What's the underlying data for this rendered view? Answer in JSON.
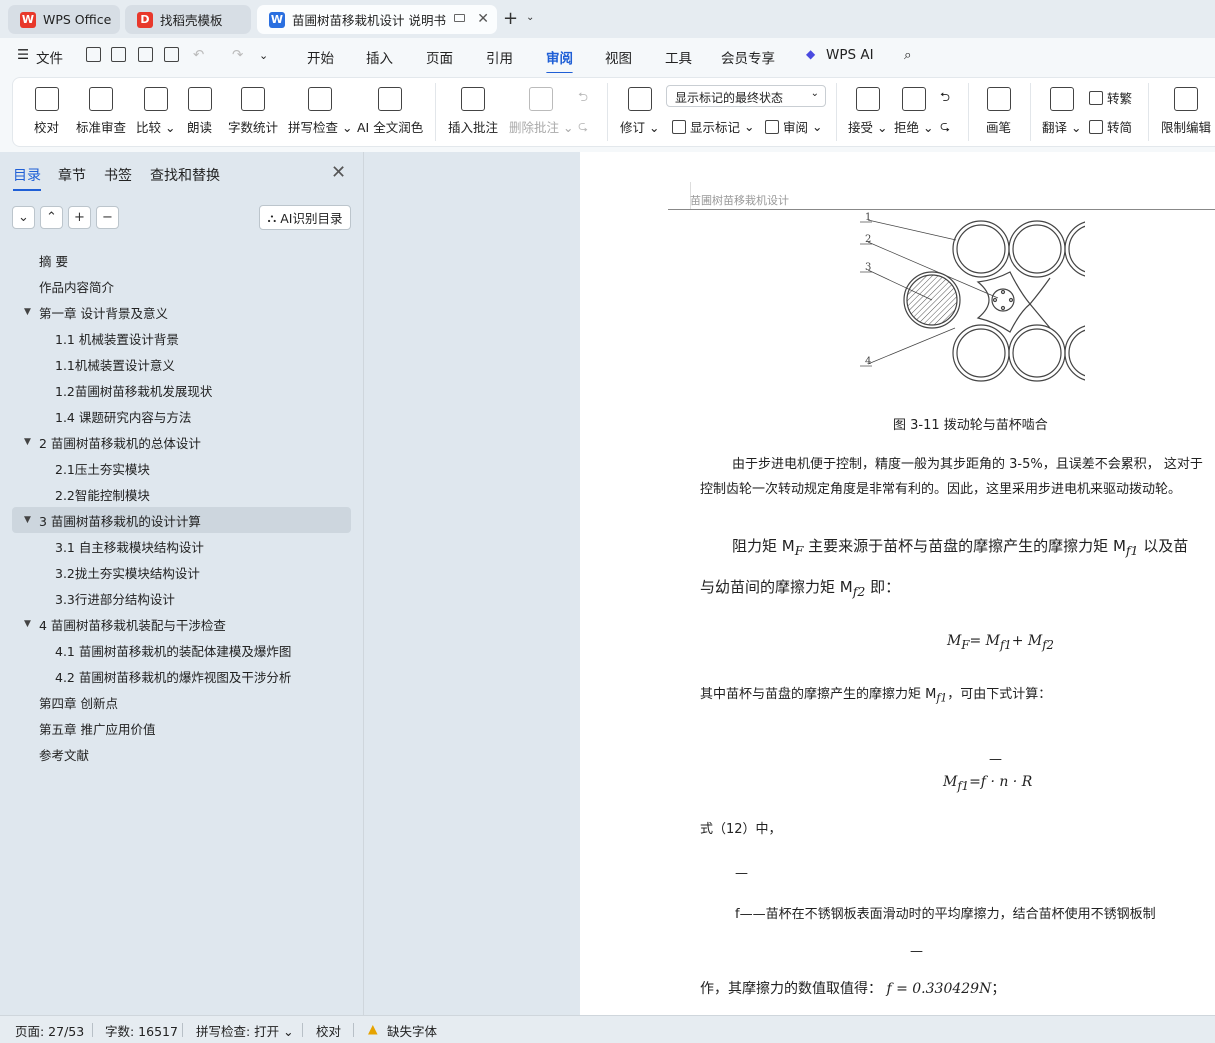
{
  "tabs": [
    {
      "label": "WPS Office",
      "icon": "wps-logo-icon",
      "color": "#e8382b"
    },
    {
      "label": "找稻壳模板",
      "icon": "docer-logo-icon",
      "color": "#e8382b"
    },
    {
      "label": "苗圃树苗移栽机设计 说明书",
      "icon": "word-doc-icon",
      "color": "#2a6fe0"
    }
  ],
  "menu": {
    "file": "文件",
    "items": [
      "开始",
      "插入",
      "页面",
      "引用",
      "审阅",
      "视图",
      "工具",
      "会员专享",
      "WPS AI"
    ],
    "active": "审阅"
  },
  "ribbon": {
    "proofread": "校对",
    "standard_review": "标准审查",
    "compare": "比较",
    "read_aloud": "朗读",
    "word_count": "字数统计",
    "spell_check": "拼写检查",
    "ai_polish": "AI 全文润色",
    "insert_comment": "插入批注",
    "delete_comment": "删除批注",
    "track_changes": "修订",
    "display_mode": "显示标记的最终状态",
    "show_markup": "显示标记",
    "review": "审阅",
    "accept": "接受",
    "reject": "拒绝",
    "pen": "画笔",
    "translate": "翻译",
    "to_traditional": "转繁",
    "to_simplified": "转简",
    "restrict_editing": "限制编辑"
  },
  "sidebar": {
    "tabs": [
      "目录",
      "章节",
      "书签",
      "查找和替换"
    ],
    "active_tab": "目录",
    "ai_button": "AI识别目录",
    "toc": [
      {
        "label": "摘    要",
        "level": 1,
        "arrow": false
      },
      {
        "label": "作品内容简介",
        "level": 1,
        "arrow": false
      },
      {
        "label": "第一章  设计背景及意义",
        "level": 1,
        "arrow": true
      },
      {
        "label": "1.1 机械装置设计背景",
        "level": 2,
        "arrow": false
      },
      {
        "label": "1.1机械装置设计意义",
        "level": 2,
        "arrow": false
      },
      {
        "label": "1.2苗圃树苗移栽机发展现状",
        "level": 2,
        "arrow": false
      },
      {
        "label": "1.4 课题研究内容与方法",
        "level": 2,
        "arrow": false
      },
      {
        "label": "2 苗圃树苗移栽机的总体设计",
        "level": 1,
        "arrow": true
      },
      {
        "label": "2.1压土夯实模块",
        "level": 2,
        "arrow": false
      },
      {
        "label": "2.2智能控制模块",
        "level": 2,
        "arrow": false
      },
      {
        "label": "3 苗圃树苗移栽机的设计计算",
        "level": 1,
        "arrow": true,
        "selected": true
      },
      {
        "label": "3.1 自主移栽模块结构设计",
        "level": 2,
        "arrow": false
      },
      {
        "label": "3.2拢土夯实模块结构设计",
        "level": 2,
        "arrow": false
      },
      {
        "label": "3.3行进部分结构设计",
        "level": 2,
        "arrow": false
      },
      {
        "label": "4 苗圃树苗移栽机装配与干涉检查",
        "level": 1,
        "arrow": true
      },
      {
        "label": "4.1  苗圃树苗移栽机的装配体建模及爆炸图",
        "level": 2,
        "arrow": false
      },
      {
        "label": "4.2 苗圃树苗移栽机的爆炸视图及干涉分析",
        "level": 2,
        "arrow": false
      },
      {
        "label": "第四章  创新点",
        "level": 1,
        "arrow": false
      },
      {
        "label": "第五章  推广应用价值",
        "level": 1,
        "arrow": false
      },
      {
        "label": "参考文献",
        "level": 1,
        "arrow": false
      }
    ]
  },
  "doc": {
    "header": "苗圃树苗移栽机设计",
    "figure_labels": [
      "1",
      "2",
      "3",
      "4"
    ],
    "caption": "图  3-11  拨动轮与苗杯啮合",
    "p1a": "由于步进电机便于控制，精度一般为其步距角的 3-5%，且误差不会累积，  这对于",
    "p1b": "控制齿轮一次转动规定角度是非常有利的。因此，这里采用步进电机来驱动拨动轮。",
    "p2a": "阻力矩 M",
    "p2a_sub": "F",
    "p2b": " 主要来源于苗杯与苗盘的摩擦产生的摩擦力矩  M",
    "p2b_sub": "f1",
    "p2c": " 以及苗",
    "p3a": "与幼苗间的摩擦力矩 M",
    "p3a_sub": "f2",
    "p3b": " 即：",
    "eq1": "M_F= M_f1+ M_f2",
    "p4a": "其中苗杯与苗盘的摩擦产生的摩擦力矩 M",
    "p4a_sub": "f1",
    "p4b": "，可由下式计算：",
    "eq2": "M_f1=f · n · R",
    "p5": "式（12）中，",
    "p6": "f——苗杯在不锈钢板表面滑动时的平均摩擦力，结合苗杯使用不锈钢板制",
    "p7a": "作，其摩擦力的数值取值得：  ",
    "p7b": "f = 0.330429N",
    "p7c": "；"
  },
  "status": {
    "page": "页面: 27/53",
    "words": "字数: 16517",
    "spell": "拼写检查: 打开",
    "proof": "校对",
    "missing_font": "缺失字体"
  }
}
